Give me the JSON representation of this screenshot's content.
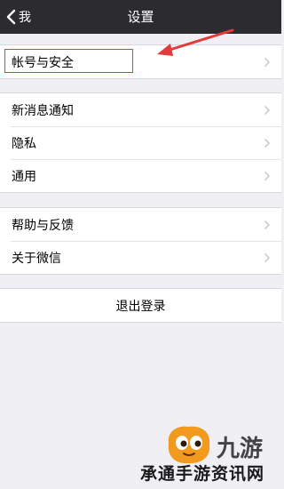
{
  "navbar": {
    "back_label": "我",
    "title": "设置"
  },
  "group_account": {
    "items": [
      {
        "label": "帐号与安全"
      }
    ]
  },
  "group_general": {
    "items": [
      {
        "label": "新消息通知"
      },
      {
        "label": "隐私"
      },
      {
        "label": "通用"
      }
    ]
  },
  "group_help": {
    "items": [
      {
        "label": "帮助与反馈"
      },
      {
        "label": "关于微信"
      }
    ]
  },
  "logout": {
    "label": "退出登录"
  },
  "annotation": {
    "highlight_color": "#e23b3b",
    "arrow_color": "#e23b3b"
  },
  "watermark": {
    "logo_text": "九游",
    "site_text": "承通手游资讯网"
  },
  "colors": {
    "navbar_bg": "#2c2b30",
    "page_bg": "#efeff4",
    "chevron": "#c7c7cc"
  }
}
